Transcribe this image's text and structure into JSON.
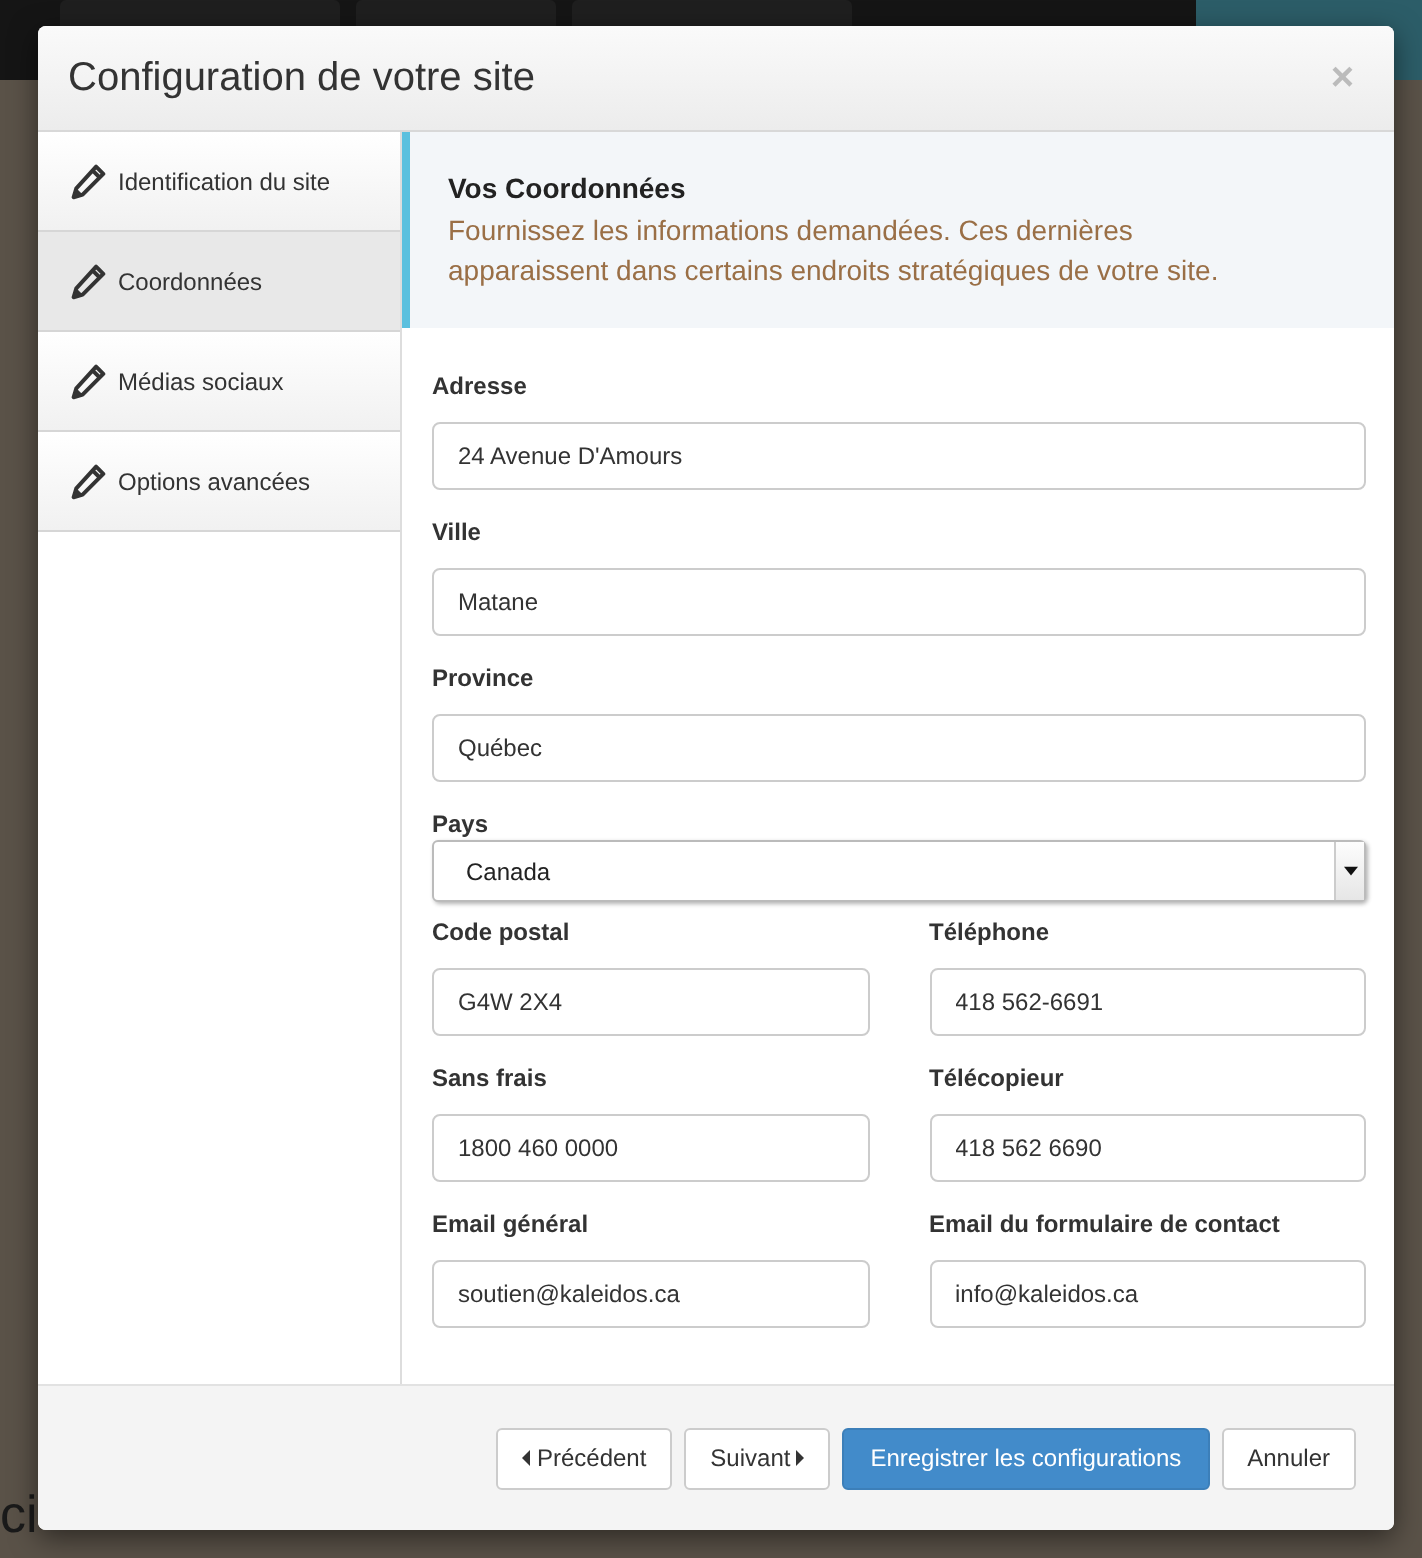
{
  "background": {
    "texts": [
      "ci"
    ]
  },
  "dialog": {
    "title": "Configuration de votre site",
    "close": "×"
  },
  "sidebar": {
    "items": [
      {
        "label": "Identification du site",
        "selected": false
      },
      {
        "label": "Coordonnées",
        "selected": true
      },
      {
        "label": "Médias sociaux",
        "selected": false
      },
      {
        "label": "Options avancées",
        "selected": false
      }
    ]
  },
  "info": {
    "title": "Vos Coordonnées",
    "text": "Fournissez les informations demandées. Ces dernières apparaissent dans certains endroits stratégiques de votre site."
  },
  "form": {
    "rows": [
      [
        {
          "label": "Adresse",
          "value": "24 Avenue D'Amours",
          "kind": "text"
        }
      ],
      [
        {
          "label": "Ville",
          "value": "Matane",
          "kind": "text"
        }
      ],
      [
        {
          "label": "Province",
          "value": "Québec",
          "kind": "text"
        }
      ],
      [
        {
          "label": "Pays",
          "value": "Canada",
          "kind": "select"
        }
      ],
      [
        {
          "label": "Code postal",
          "value": "G4W 2X4",
          "kind": "text"
        },
        {
          "label": "Téléphone",
          "value": "418 562-6691",
          "kind": "text"
        }
      ],
      [
        {
          "label": "Sans frais",
          "value": "1800 460 0000",
          "kind": "text"
        },
        {
          "label": "Télécopieur",
          "value": "418 562 6690",
          "kind": "text"
        }
      ],
      [
        {
          "label": "Email général",
          "value": "soutien@kaleidos.ca",
          "kind": "text"
        },
        {
          "label": "Email du formulaire de contact",
          "value": "info@kaleidos.ca",
          "kind": "text"
        }
      ]
    ]
  },
  "footer": {
    "buttons": [
      {
        "label": "Précédent",
        "kind": "prev"
      },
      {
        "label": "Suivant",
        "kind": "next"
      },
      {
        "label": "Enregistrer les configurations",
        "kind": "primary"
      },
      {
        "label": "Annuler",
        "kind": "default"
      }
    ]
  }
}
